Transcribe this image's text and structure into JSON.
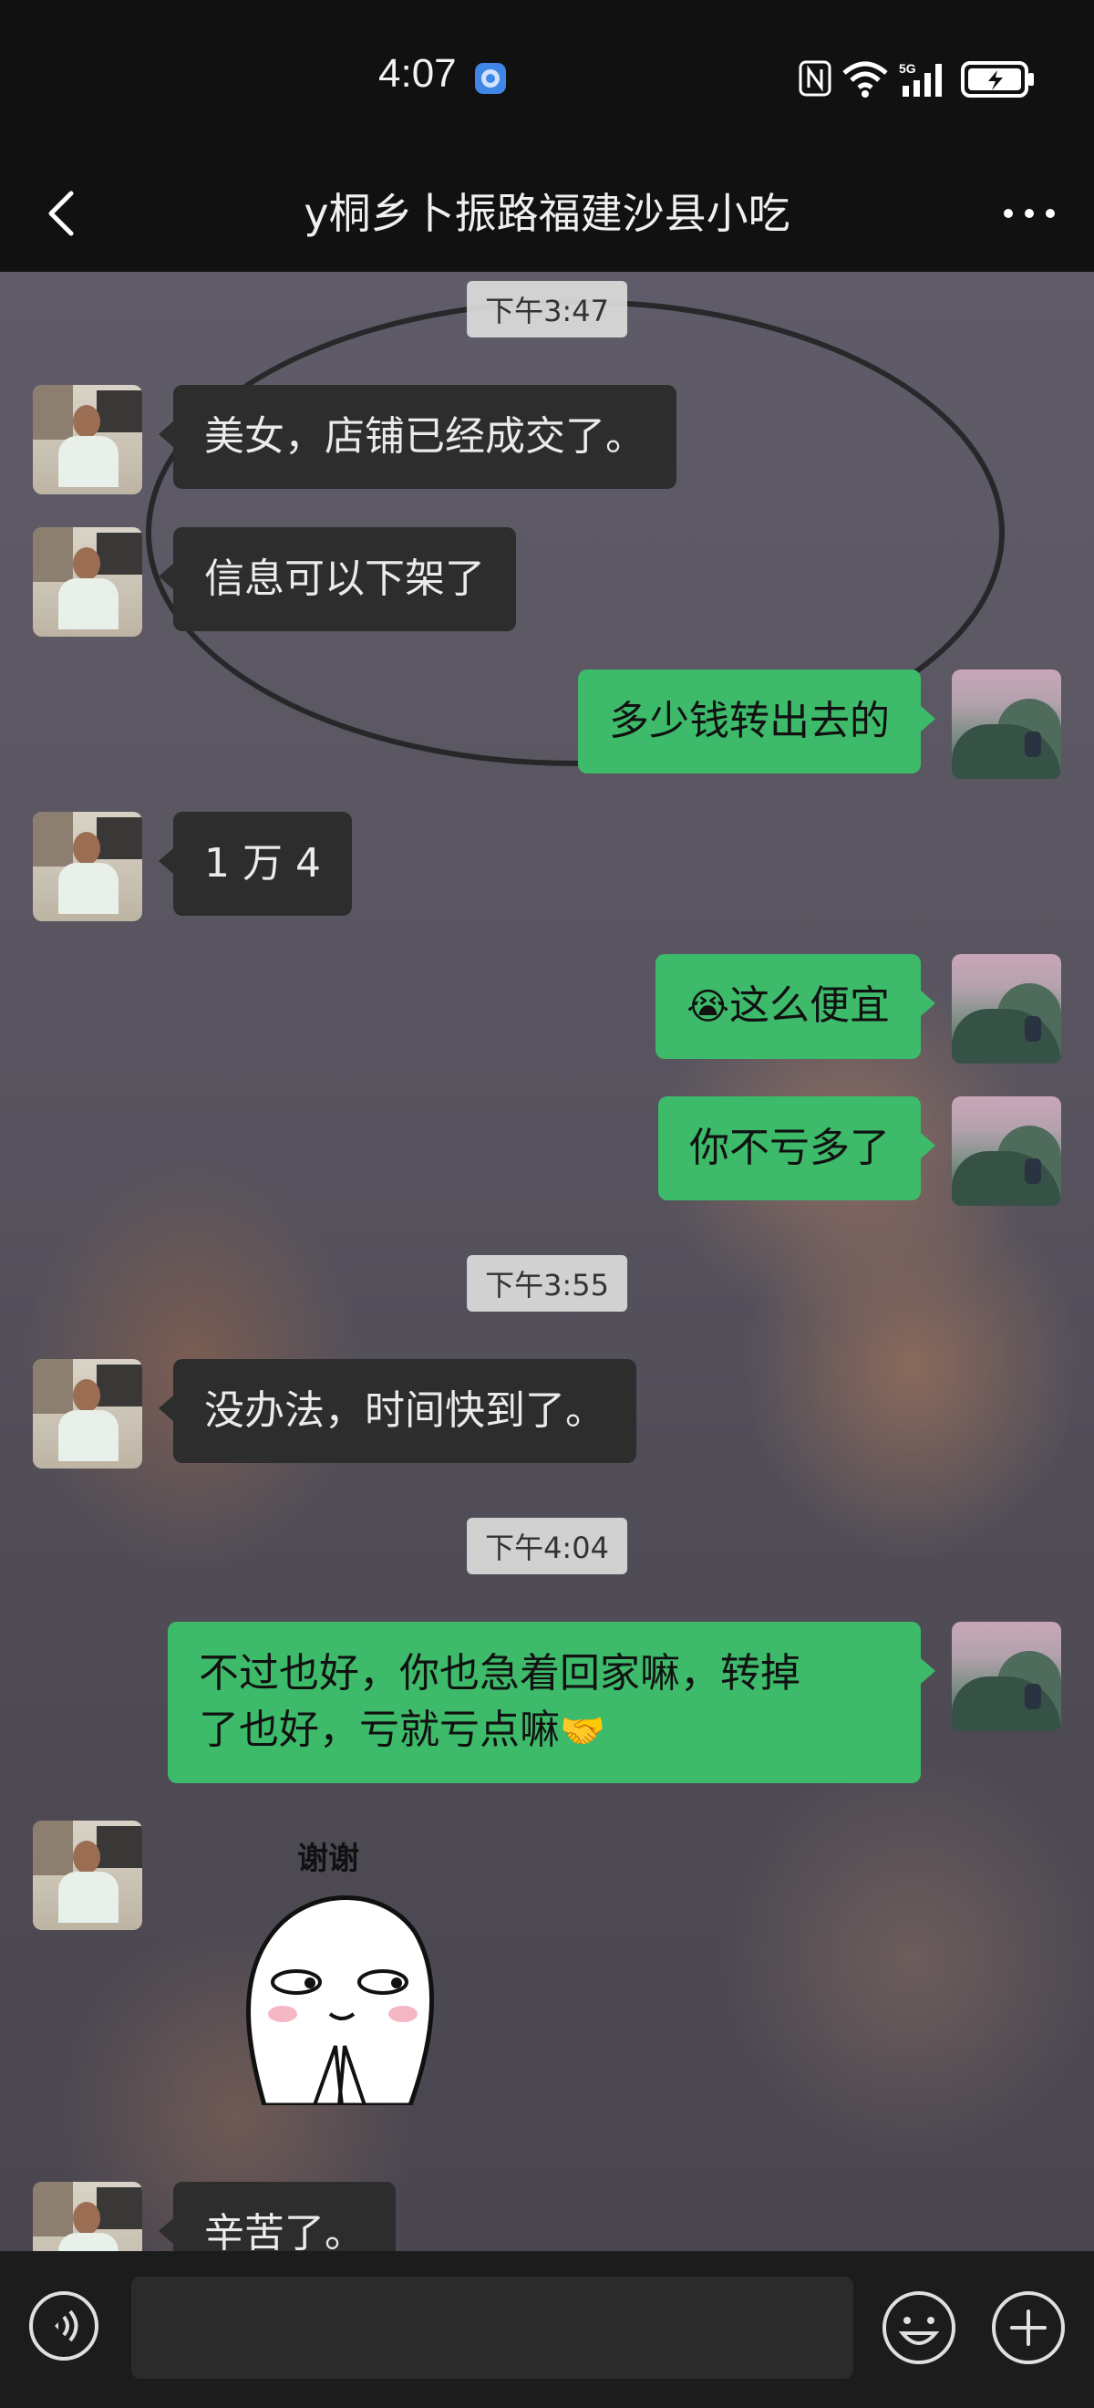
{
  "status_bar": {
    "time": "4:07",
    "icons": [
      "app-notification-icon",
      "nfc-icon",
      "wifi-icon",
      "signal-5g-icon",
      "battery-charging-icon"
    ],
    "network_label": "5G"
  },
  "header": {
    "title": "y桐乡卜振路福建沙县小吃",
    "back_icon": "chevron-left-icon",
    "more_icon": "more-dots-icon"
  },
  "messages": [
    {
      "type": "timestamp",
      "text": "下午3:47"
    },
    {
      "type": "message",
      "side": "left",
      "text": "美女，店铺已经成交了。"
    },
    {
      "type": "message",
      "side": "left",
      "text": "信息可以下架了"
    },
    {
      "type": "message",
      "side": "right",
      "text": "多少钱转出去的"
    },
    {
      "type": "message",
      "side": "left",
      "text": "1 万 4"
    },
    {
      "type": "message",
      "side": "right",
      "emoji": "😭",
      "text": "这么便宜"
    },
    {
      "type": "message",
      "side": "right",
      "text": "你不亏多了"
    },
    {
      "type": "timestamp",
      "text": "下午3:55"
    },
    {
      "type": "message",
      "side": "left",
      "text": "没办法，时间快到了。"
    },
    {
      "type": "timestamp",
      "text": "下午4:04"
    },
    {
      "type": "message",
      "side": "right",
      "line1": "不过也好，你也急着回家嘛，转掉",
      "line2": "了也好，亏就亏点嘛",
      "emoji": "🤝"
    },
    {
      "type": "sticker",
      "side": "left",
      "caption": "谢谢"
    },
    {
      "type": "message",
      "side": "left",
      "text": "辛苦了。"
    }
  ],
  "input_bar": {
    "voice_icon": "voice-icon",
    "input_value": "",
    "emoji_icon": "emoji-face-icon",
    "plus_icon": "plus-circle-icon"
  },
  "colors": {
    "sent_bubble": "#3dbb6a",
    "received_bubble": "#2d2d2d",
    "background": "#111111"
  }
}
